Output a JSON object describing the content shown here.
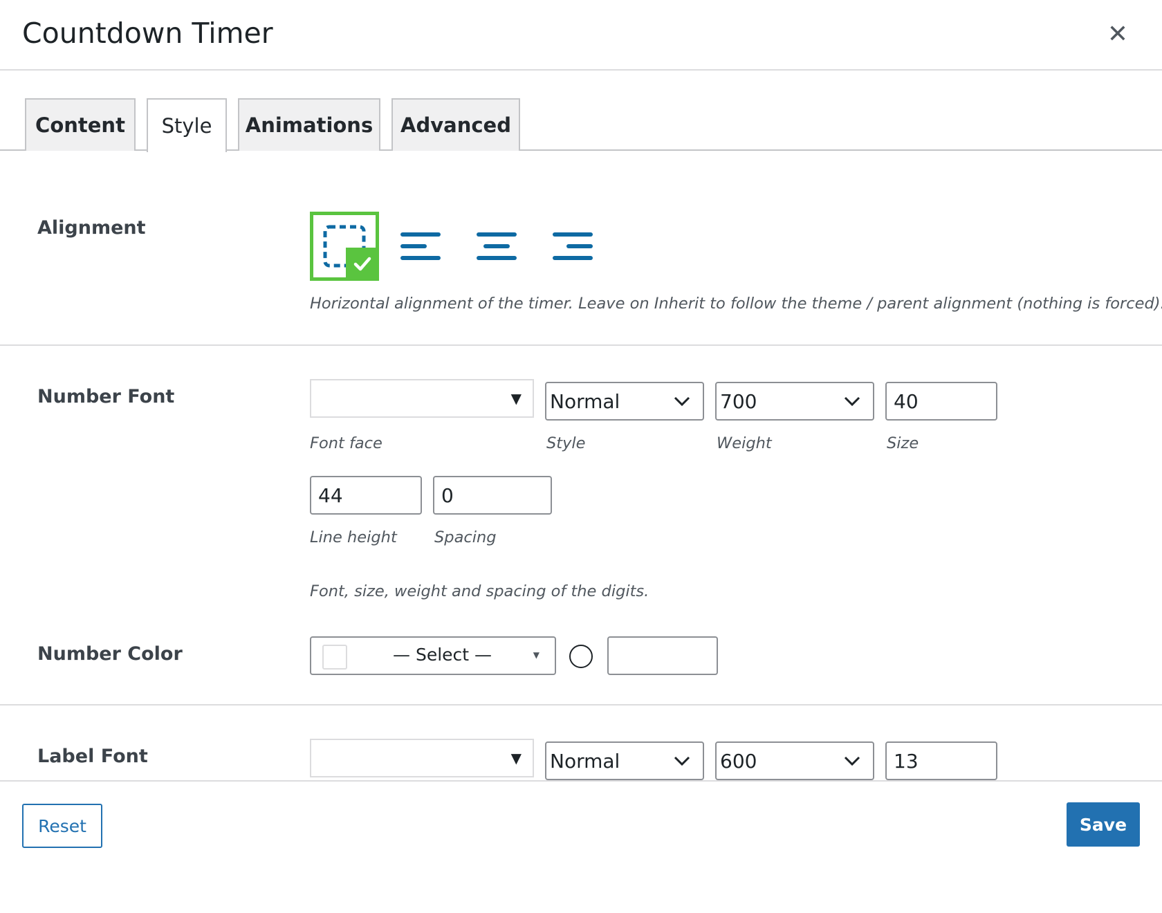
{
  "dialog": {
    "title": "Countdown Timer",
    "close_icon": "close-icon"
  },
  "tabs": [
    {
      "label": "Content",
      "active": false
    },
    {
      "label": "Style",
      "active": true
    },
    {
      "label": "Animations",
      "active": false
    },
    {
      "label": "Advanced",
      "active": false
    }
  ],
  "alignment": {
    "label": "Alignment",
    "options": [
      "inherit-icon",
      "align-left-icon",
      "align-center-icon",
      "align-right-icon"
    ],
    "selected": "inherit",
    "hint": "Horizontal alignment of the timer. Leave on Inherit to follow the theme / parent alignment (nothing is forced)."
  },
  "number_font": {
    "label": "Number Font",
    "font_face": "",
    "font_face_label": "Font face",
    "style": "Normal",
    "style_label": "Style",
    "weight": "700",
    "weight_label": "Weight",
    "size": "40",
    "size_label": "Size",
    "line_height": "44",
    "line_height_label": "Line height",
    "spacing": "0",
    "spacing_label": "Spacing",
    "hint": "Font, size, weight and spacing of the digits."
  },
  "number_color": {
    "label": "Number Color",
    "select_text": "— Select —",
    "value": ""
  },
  "label_font": {
    "label": "Label Font",
    "font_face": "",
    "style": "Normal",
    "weight": "600",
    "size": "13"
  },
  "footer": {
    "reset_label": "Reset",
    "save_label": "Save"
  },
  "colors": {
    "accent": "#2271b1",
    "selected": "#5ac43f",
    "icon_blue": "#0e6aa3"
  }
}
